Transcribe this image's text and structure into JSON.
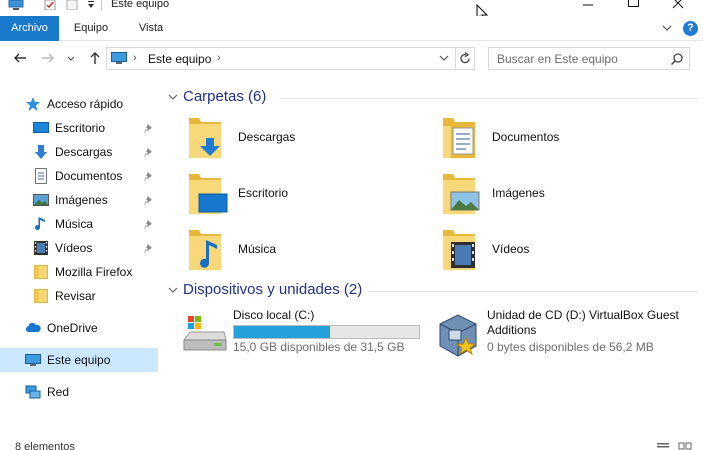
{
  "window": {
    "title": "Este equipo"
  },
  "ribbon": {
    "tabs": [
      "Archivo",
      "Equipo",
      "Vista"
    ],
    "help": "?"
  },
  "address": {
    "path": "Este equipo",
    "search_placeholder": "Buscar en Este equipo"
  },
  "nav": {
    "quick_access": "Acceso rápido",
    "quick_items": [
      {
        "label": "Escritorio",
        "icon": "desktop-icon",
        "pinned": true
      },
      {
        "label": "Descargas",
        "icon": "download-icon",
        "pinned": true
      },
      {
        "label": "Documentos",
        "icon": "document-icon",
        "pinned": true
      },
      {
        "label": "Imágenes",
        "icon": "pictures-icon",
        "pinned": true
      },
      {
        "label": "Música",
        "icon": "music-icon",
        "pinned": true
      },
      {
        "label": "Vídeos",
        "icon": "video-icon",
        "pinned": true
      },
      {
        "label": "Mozilla Firefox",
        "icon": "folder-icon",
        "pinned": false
      },
      {
        "label": "Revisar",
        "icon": "folder-icon",
        "pinned": false
      }
    ],
    "onedrive": "OneDrive",
    "this_pc": "Este equipo",
    "network": "Red"
  },
  "content": {
    "folders_header": "Carpetas (6)",
    "folders": [
      {
        "label": "Descargas",
        "icon": "download-folder-icon"
      },
      {
        "label": "Documentos",
        "icon": "documents-folder-icon"
      },
      {
        "label": "Escritorio",
        "icon": "desktop-folder-icon"
      },
      {
        "label": "Imágenes",
        "icon": "pictures-folder-icon"
      },
      {
        "label": "Música",
        "icon": "music-folder-icon"
      },
      {
        "label": "Vídeos",
        "icon": "videos-folder-icon"
      }
    ],
    "devices_header": "Dispositivos y unidades (2)",
    "drives": [
      {
        "name": "Disco local (C:)",
        "free": "15,0 GB disponibles de 31,5 GB",
        "used_fraction": 0.52,
        "icon": "hard-drive-icon"
      },
      {
        "name": "Unidad de CD (D:) VirtualBox Guest",
        "name_line2": "Additions",
        "free": "0 bytes disponibles de 56,2 MB",
        "icon": "virtualbox-cd-icon"
      }
    ]
  },
  "status": {
    "items": "8 elementos"
  },
  "colors": {
    "accent": "#1979ca",
    "header_text": "#1e3287",
    "selected_bg": "#cce8ff",
    "drive_fill": "#26a0da"
  }
}
